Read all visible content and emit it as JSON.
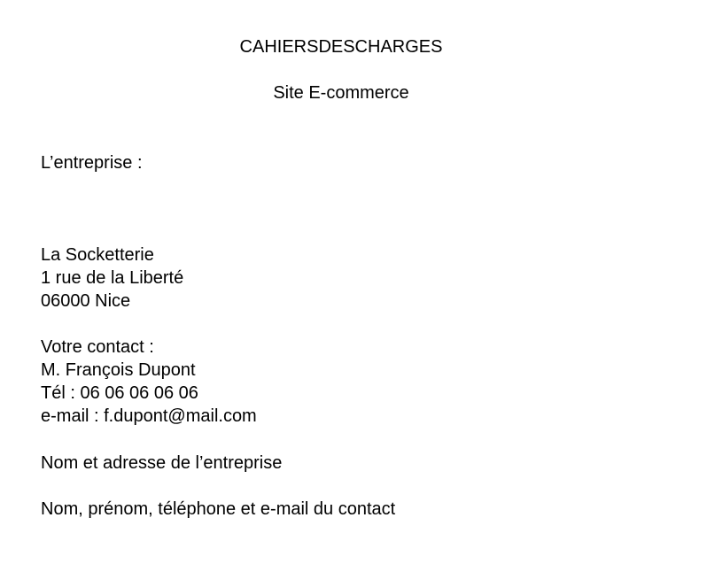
{
  "document": {
    "title": "CAHIERSDESCHARGES",
    "subtitle": "Site E-commerce",
    "company_heading": "L’entreprise :",
    "company": {
      "name": "La Socketterie",
      "street": "1 rue de la Liberté",
      "city": "06000 Nice"
    },
    "contact": {
      "heading": "Votre contact :",
      "name": "M. François Dupont",
      "phone": "Tél : 06 06 06 06 06",
      "email": "e-mail : f.dupont@mail.com"
    },
    "notes": [
      "Nom et adresse de l’entreprise",
      "Nom, prénom, téléphone et e-mail du contact"
    ]
  }
}
